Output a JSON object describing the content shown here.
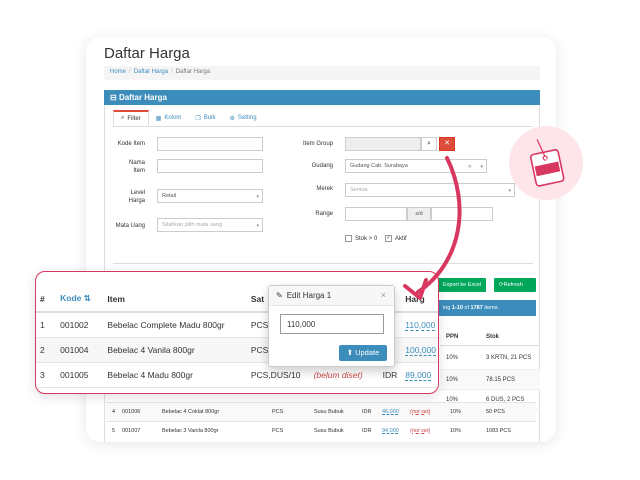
{
  "page": {
    "title": "Daftar Harga"
  },
  "breadcrumb": [
    "Home",
    "Daftar Harga",
    "Daftar Harga"
  ],
  "panel": {
    "title": "Daftar Harga"
  },
  "tabs": [
    {
      "label": "Filter",
      "icon": "search-icon"
    },
    {
      "label": "Kolom",
      "icon": "table-icon"
    },
    {
      "label": "Bulk",
      "icon": "copy-icon"
    },
    {
      "label": "Setting",
      "icon": "gear-icon"
    }
  ],
  "filters": {
    "kode_item": {
      "label": "Kode Item",
      "value": ""
    },
    "nama_item": {
      "label": "Nama Item",
      "value": ""
    },
    "level_harga": {
      "label": "Level Harga",
      "value": "Retail"
    },
    "mata_uang": {
      "label": "Mata Uang",
      "placeholder": "Silahkan pilih mata uang"
    },
    "item_group": {
      "label": "Item Group",
      "value": ""
    },
    "gudang": {
      "label": "Gudang",
      "value": "Gudang Cab. Surabaya"
    },
    "merek": {
      "label": "Merek",
      "value": "Semua"
    },
    "range": {
      "label": "Range",
      "separator": "s/d"
    },
    "stok": {
      "label": "Stok > 0",
      "checked": false
    },
    "aktif": {
      "label": "Aktif",
      "checked": true
    }
  },
  "toolbar": {
    "export_label": "Export ke Excel",
    "refresh_label": "Refresh"
  },
  "summary": {
    "prefix": "ing",
    "range": "1-10",
    "of": "of",
    "total": "1787",
    "suffix": "items."
  },
  "background_table": {
    "headers": {
      "ppn": "PPN",
      "stok": "Stok"
    },
    "right_rows": [
      {
        "ppn": "10%",
        "stok": "3 KRTN, 21 PCS"
      },
      {
        "ppn": "10%",
        "stok": "78.15 PCS"
      },
      {
        "ppn": "10%",
        "stok": "6 DUS, 2 PCS"
      }
    ],
    "rows": [
      {
        "no": "4",
        "kode": "001006",
        "nama": "Bebelac 4 Coklat 800gr",
        "satuan": "PCS",
        "group": "Susu Bubuk",
        "cur": "IDR",
        "harga": "46,000",
        "note": "(not set)",
        "ppn": "10%",
        "stok": "50 PCS"
      },
      {
        "no": "5",
        "kode": "001007",
        "nama": "Bebelac 3 Vanila 800gr",
        "satuan": "PCS",
        "group": "Susu Bubuk",
        "cur": "IDR",
        "harga": "94,000",
        "note": "(not set)",
        "ppn": "10%",
        "stok": "1083 PCS"
      }
    ]
  },
  "overlay_table": {
    "headers": {
      "no": "#",
      "kode": "Kode",
      "item": "Item",
      "satuan": "Sat",
      "harga": "Harg"
    },
    "rows": [
      {
        "no": "1",
        "kode": "001002",
        "item": "Bebelac Complete Madu 800gr",
        "satuan": "PCS",
        "harga": "110,000"
      },
      {
        "no": "2",
        "kode": "001004",
        "item": "Bebelac 4 Vanila 800gr",
        "satuan": "PCS",
        "harga": "100,000"
      },
      {
        "no": "3",
        "kode": "001005",
        "item": "Bebelac 4 Madu 800gr",
        "satuan": "PCS,DUS/10",
        "status": "(belum diset)",
        "currency": "IDR",
        "harga": "89,000"
      }
    ]
  },
  "popover": {
    "title": "Edit Harga 1",
    "value": "110,000",
    "update_label": "Update"
  },
  "sale_tag": {
    "label": "SALE"
  },
  "colors": {
    "primary": "#3c8dbc",
    "success": "#00a65a",
    "danger": "#dd4b39",
    "accent": "#d8375f"
  }
}
